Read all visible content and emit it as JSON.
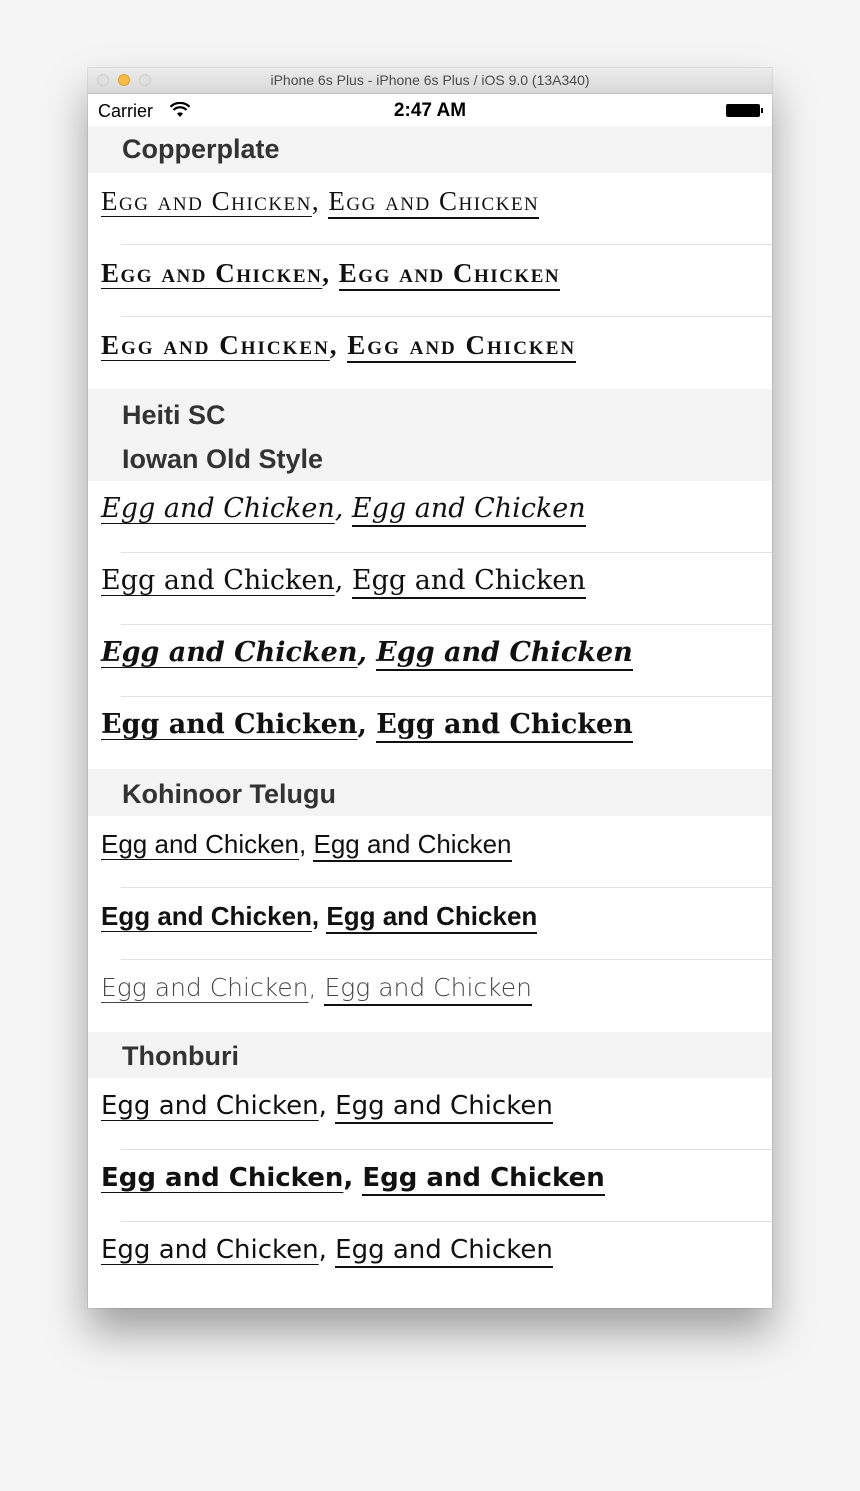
{
  "window": {
    "title": "iPhone 6s Plus - iPhone 6s Plus / iOS 9.0 (13A340)"
  },
  "statusbar": {
    "carrier": "Carrier",
    "time": "2:47 AM"
  },
  "sections": {
    "copperplate": {
      "header": "Copperplate",
      "rows": [
        {
          "a": "Egg and Chicken",
          "sep": ", ",
          "b": "Egg and Chicken"
        },
        {
          "a": "Egg and Chicken",
          "sep": ", ",
          "b": "Egg and Chicken"
        },
        {
          "a": "Egg and Chicken",
          "sep": ", ",
          "b": "Egg and Chicken"
        }
      ]
    },
    "heiti": {
      "header": "Heiti SC"
    },
    "iowan": {
      "header": "Iowan Old Style",
      "rows": [
        {
          "a": "Egg and Chicken",
          "sep": ", ",
          "b": "Egg and Chicken"
        },
        {
          "a": "Egg and Chicken",
          "sep": ", ",
          "b": "Egg and Chicken"
        },
        {
          "a": "Egg and Chicken",
          "sep": ", ",
          "b": "Egg and Chicken"
        },
        {
          "a": "Egg and Chicken",
          "sep": ", ",
          "b": "Egg and Chicken"
        }
      ]
    },
    "kohinoor": {
      "header": "Kohinoor Telugu",
      "rows": [
        {
          "a": "Egg and Chicken",
          "sep": ", ",
          "b": "Egg and Chicken"
        },
        {
          "a": "Egg and Chicken",
          "sep": ", ",
          "b": "Egg and Chicken"
        },
        {
          "a": "Egg and Chicken",
          "sep": ", ",
          "b": "Egg and Chicken"
        }
      ]
    },
    "thonburi": {
      "header": "Thonburi",
      "rows": [
        {
          "a": "Egg and Chicken",
          "sep": ", ",
          "b": "Egg and Chicken"
        },
        {
          "a": "Egg and Chicken",
          "sep": ", ",
          "b": "Egg and Chicken"
        },
        {
          "a": "Egg and Chicken",
          "sep": ", ",
          "b": "Egg and Chicken"
        }
      ]
    }
  }
}
